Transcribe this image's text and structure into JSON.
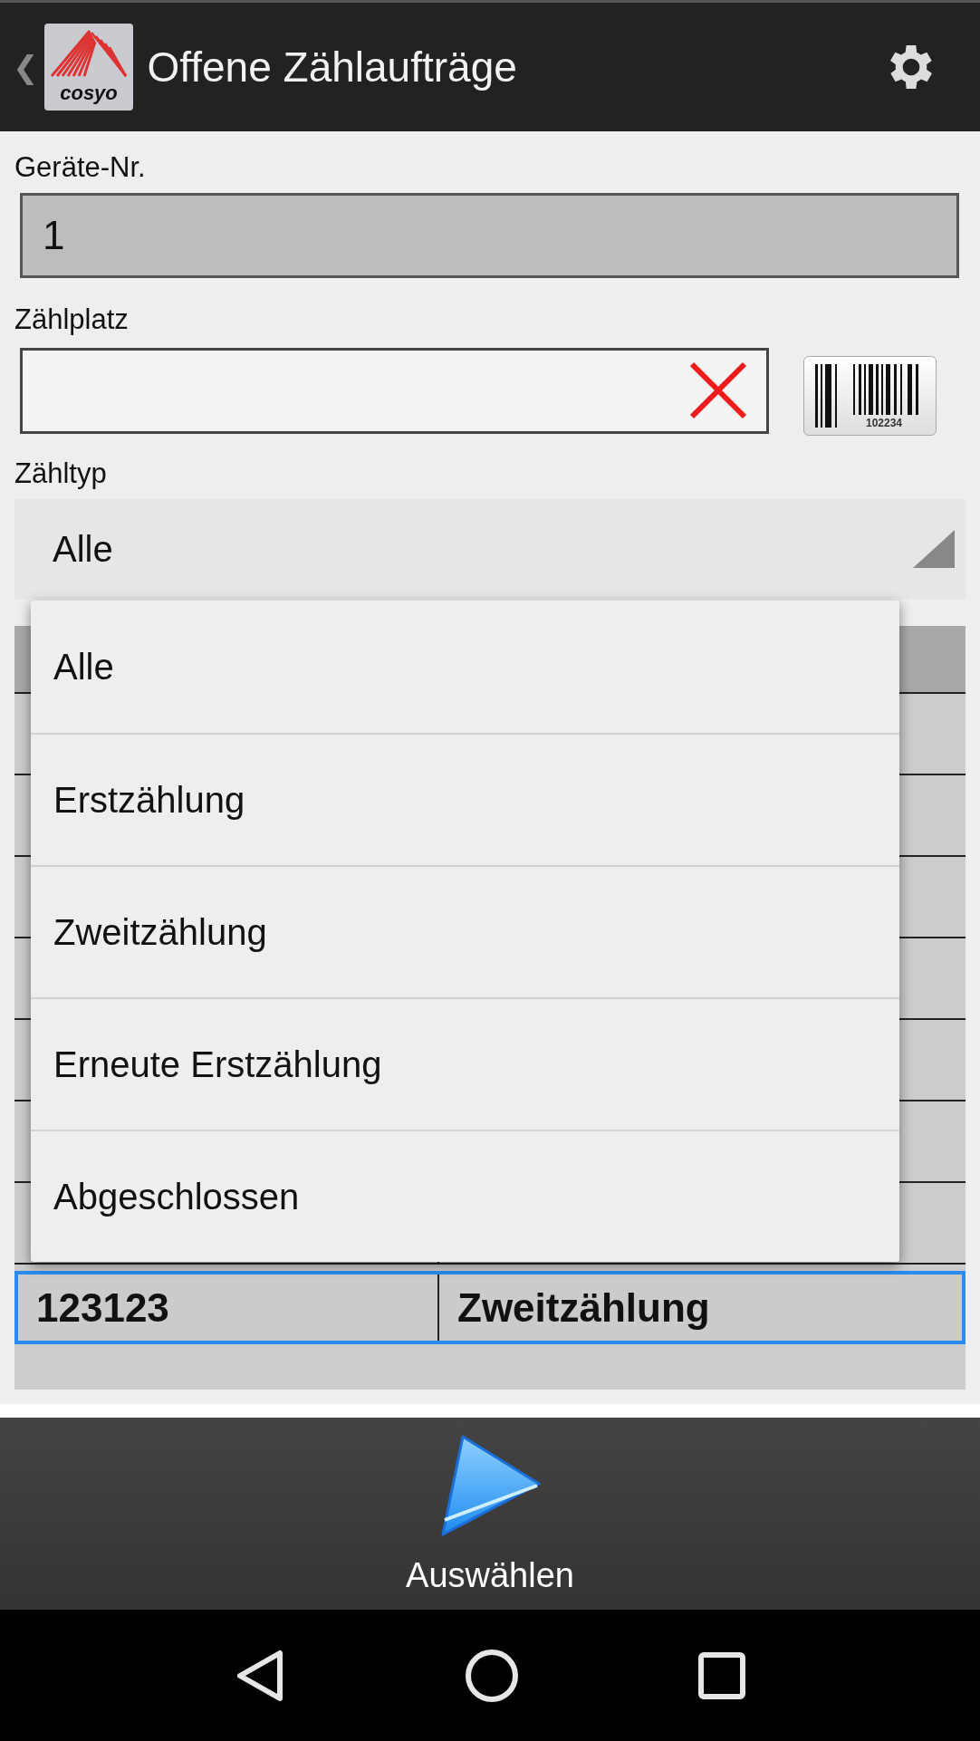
{
  "header": {
    "back": "❮",
    "logo_text": "cosyo",
    "title": "Offene Zählaufträge"
  },
  "device_field": {
    "label": "Geräte-Nr.",
    "value": "1"
  },
  "place_field": {
    "label": "Zählplatz",
    "barcode_caption": "102234"
  },
  "type_spinner": {
    "label": "Zähltyp",
    "value": "Alle"
  },
  "dropdown": {
    "options": [
      "Alle",
      "Erstzählung",
      "Zweitzählung",
      "Erneute Erstzählung",
      "Abgeschlossen"
    ]
  },
  "table": {
    "rows": [
      {
        "cells": [
          "123123",
          "Zweitzählung"
        ],
        "selected": true
      }
    ]
  },
  "action": {
    "label": "Auswählen"
  }
}
